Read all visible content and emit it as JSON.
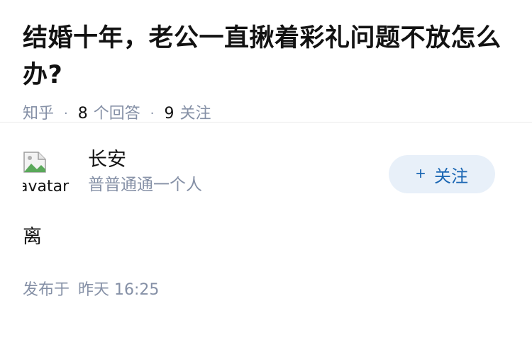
{
  "question": {
    "title": "结婚十年，老公一直揪着彩礼问题不放怎么办?",
    "source": "知乎",
    "answer_count": "8",
    "answer_label": "个回答",
    "follower_count": "9",
    "follower_label": "关注"
  },
  "answer": {
    "author": {
      "avatar_alt": "avatar",
      "name": "长安",
      "bio": "普普通通一个人"
    },
    "follow_button": {
      "plus": "+",
      "label": "关注"
    },
    "content": "离",
    "published_label": "发布于",
    "published_time": "昨天 16:25"
  },
  "colors": {
    "meta_gray": "#8590a6",
    "follow_bg": "#e8f0f9",
    "follow_text": "#1a66b3",
    "divider": "#ebebeb"
  }
}
